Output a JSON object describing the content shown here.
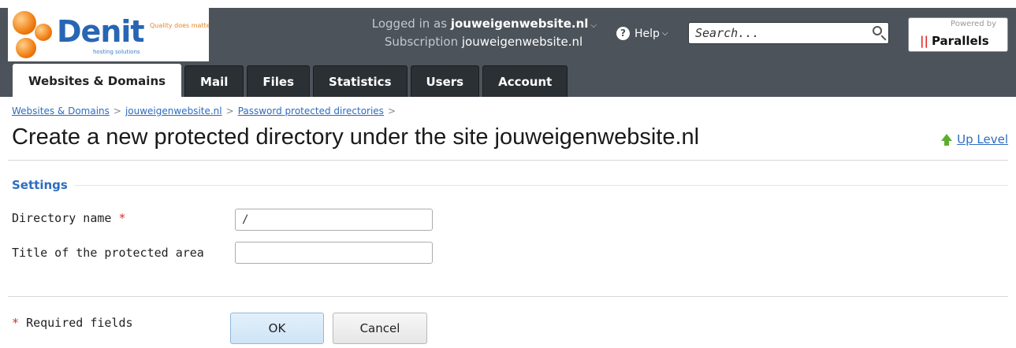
{
  "brand": {
    "name": "Denit",
    "tagline": "Quality does matter",
    "subtitle": "hosting solutions"
  },
  "header": {
    "logged_in_label": "Logged in as",
    "logged_in_value": "jouweigenwebsite.nl",
    "subscription_label": "Subscription",
    "subscription_value": "jouweigenwebsite.nl",
    "help_label": "Help",
    "search_placeholder": "Search...",
    "powered_by": "Powered by",
    "powered_brand": "Parallels"
  },
  "tabs": [
    {
      "label": "Websites & Domains",
      "active": true
    },
    {
      "label": "Mail"
    },
    {
      "label": "Files"
    },
    {
      "label": "Statistics"
    },
    {
      "label": "Users"
    },
    {
      "label": "Account"
    }
  ],
  "breadcrumb": {
    "items": [
      "Websites & Domains",
      "jouweigenwebsite.nl",
      "Password protected directories"
    ],
    "separator": ">"
  },
  "page": {
    "title": "Create a new protected directory under the site jouweigenwebsite.nl",
    "up_level": "Up Level"
  },
  "form": {
    "section_title": "Settings",
    "directory_name_label": "Directory name",
    "required_marker": "*",
    "directory_name_value": "/",
    "protected_area_label": "Title of the protected area",
    "protected_area_value": "",
    "required_fields_note": "Required fields",
    "ok_label": "OK",
    "cancel_label": "Cancel"
  },
  "colors": {
    "header_bg": "#4c535a",
    "tab_bg": "#2b3035",
    "link": "#2d6cc0",
    "required": "#d32f2f",
    "brand_orange": "#f07d12",
    "brand_blue": "#2866b4"
  }
}
